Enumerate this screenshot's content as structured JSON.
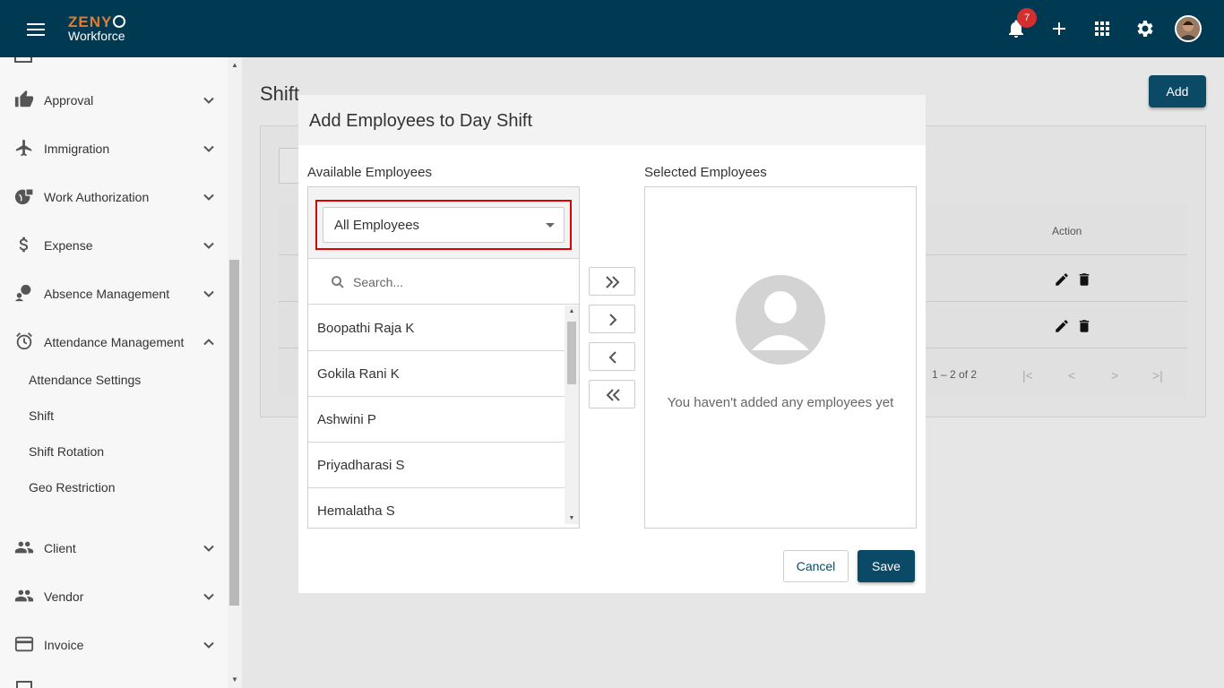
{
  "header": {
    "logo_top": "ZENY",
    "logo_bottom": "Workforce",
    "notification_count": "7",
    "icons": [
      "menu-icon",
      "bell-icon",
      "plus-icon",
      "apps-grid-icon",
      "gear-icon",
      "avatar"
    ]
  },
  "sidebar": {
    "items": [
      {
        "label": "Approval",
        "icon": "thumbs-up-icon"
      },
      {
        "label": "Immigration",
        "icon": "airplane-icon"
      },
      {
        "label": "Work Authorization",
        "icon": "globe-lock-icon"
      },
      {
        "label": "Expense",
        "icon": "dollar-icon"
      },
      {
        "label": "Absence Management",
        "icon": "person-pin-icon"
      },
      {
        "label": "Attendance Management",
        "icon": "alarm-clock-icon"
      },
      {
        "label": "Client",
        "icon": "people-icon"
      },
      {
        "label": "Vendor",
        "icon": "people-icon"
      },
      {
        "label": "Invoice",
        "icon": "credit-card-icon"
      }
    ],
    "subitems": [
      "Attendance Settings",
      "Shift",
      "Shift Rotation",
      "Geo Restriction"
    ]
  },
  "page": {
    "title": "Shift",
    "add_label": "Add",
    "action_header": "Action",
    "pagination": "1 – 2 of 2"
  },
  "dialog": {
    "title": "Add Employees to Day Shift",
    "available_title": "Available Employees",
    "selected_title": "Selected Employees",
    "filter_value": "All Employees",
    "search_placeholder": "Search...",
    "employees": [
      "Boopathi Raja K",
      "Gokila Rani K",
      "Ashwini P",
      "Priyadharasi S",
      "Hemalatha S"
    ],
    "empty_text": "You haven't added any employees yet",
    "cancel_label": "Cancel",
    "save_label": "Save"
  },
  "colors": {
    "header_bg": "#003a52",
    "primary": "#0b4a66",
    "accent_orange": "#e57b2e",
    "highlight_red": "#e00000",
    "badge_red": "#d32f2f"
  }
}
